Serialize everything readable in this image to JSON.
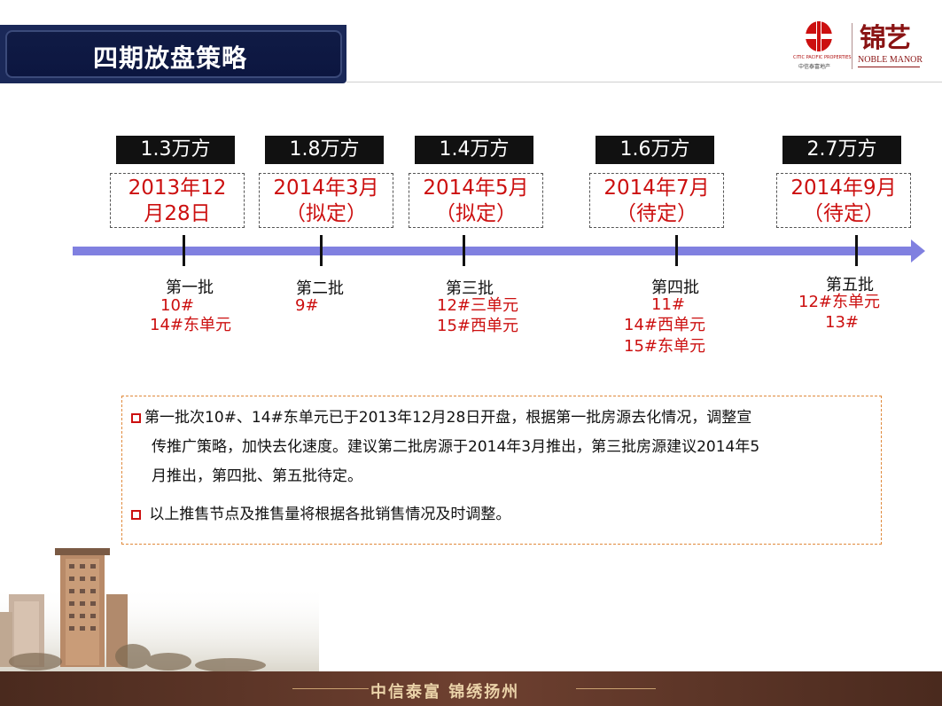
{
  "title": "四期放盘策略",
  "brand": {
    "citic_en": "CITIC PACIFIC PROPERTIES",
    "citic_cn": "中信泰富地产",
    "noble_cn": "锦艺",
    "noble_en": "NOBLE MANOR"
  },
  "timeline": [
    {
      "volume": "1.3万方",
      "date_line1": "2013年12",
      "date_line2": "月28日",
      "batch": "第一批",
      "units": [
        "10#",
        "14#东单元"
      ]
    },
    {
      "volume": "1.8万方",
      "date_line1": "2014年3月",
      "date_line2": "（拟定）",
      "batch": "第二批",
      "units": [
        "9#"
      ]
    },
    {
      "volume": "1.4万方",
      "date_line1": "2014年5月",
      "date_line2": "（拟定）",
      "batch": "第三批",
      "units": [
        "12#三单元",
        "15#西单元"
      ]
    },
    {
      "volume": "1.6万方",
      "date_line1": "2014年7月",
      "date_line2": "（待定）",
      "batch": "第四批",
      "units": [
        "11#",
        "14#西单元",
        "15#东单元"
      ]
    },
    {
      "volume": "2.7万方",
      "date_line1": "2014年9月",
      "date_line2": "（待定）",
      "batch": "第五批",
      "units": [
        "12#东单元",
        "13#"
      ]
    }
  ],
  "notes": [
    {
      "lines": [
        "第一批次10#、14#东单元已于2013年12月28日开盘，根据第一批房源去化情况，调整宣",
        "传推广策略，加快去化速度。建议第二批房源于2014年3月推出，第三批房源建议2014年5",
        "月推出，第四批、第五批待定。"
      ]
    },
    {
      "lines": [
        " 以上推售节点及推售量将根据各批销售情况及时调整。"
      ]
    }
  ],
  "footer": "中信泰富  锦绣扬州",
  "colors": {
    "title_bg": "#1a2858",
    "accent_red": "#cc1010",
    "axis": "#8080e0",
    "footer_bg": "#5a3426"
  }
}
